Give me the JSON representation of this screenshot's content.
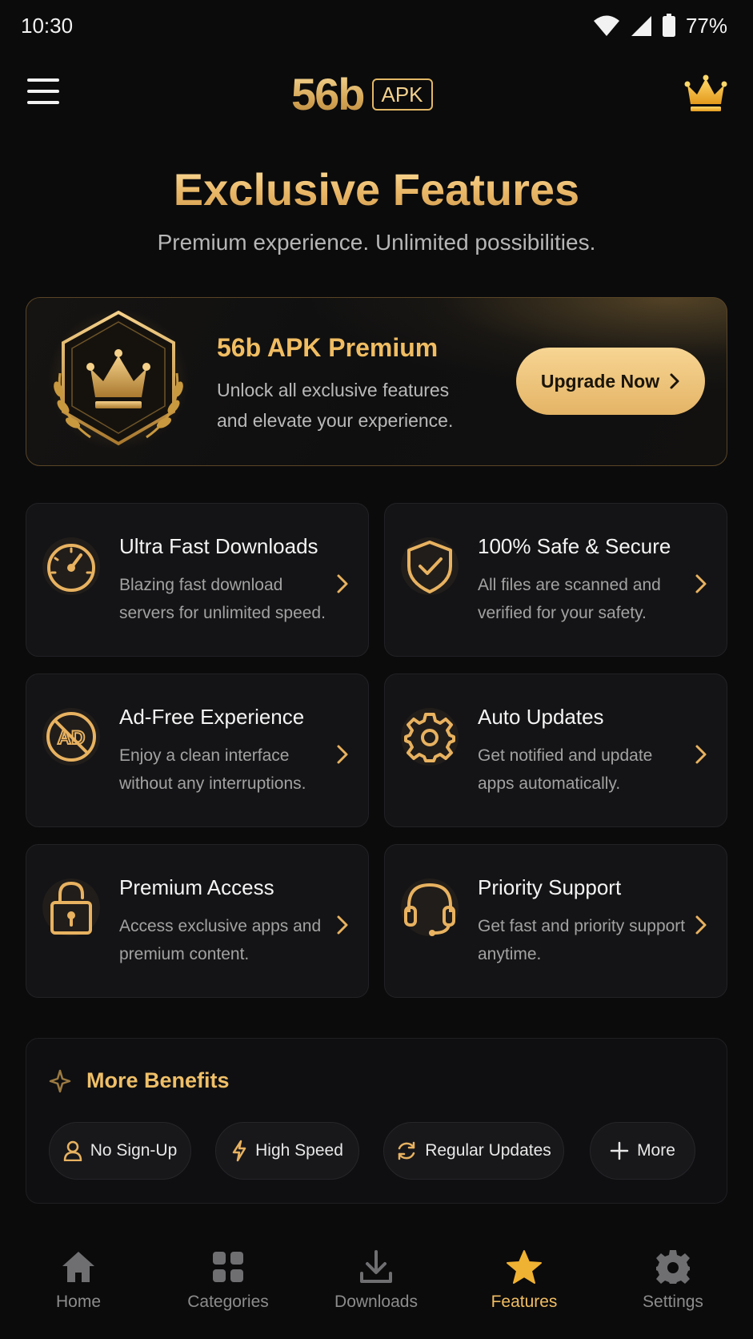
{
  "status_bar": {
    "time": "10:30",
    "battery": "77%"
  },
  "app_bar": {
    "logo_text": "56b",
    "logo_badge": "APK"
  },
  "hero": {
    "title": "Exclusive Features",
    "subtitle": "Premium experience. Unlimited possibilities."
  },
  "premium": {
    "title": "56b APK Premium",
    "description": "Unlock all exclusive features and elevate your experience.",
    "button_label": "Upgrade Now"
  },
  "features": [
    {
      "title": "Ultra Fast Downloads",
      "description": "Blazing fast download servers for unlimited speed.",
      "icon": "speedometer-icon"
    },
    {
      "title": "100% Safe & Secure",
      "description": "All files are scanned and verified for your safety.",
      "icon": "shield-check-icon"
    },
    {
      "title": "Ad-Free Experience",
      "description": "Enjoy a clean interface without any interruptions.",
      "icon": "no-ads-icon"
    },
    {
      "title": "Auto Updates",
      "description": "Get notified and update apps automatically.",
      "icon": "gear-icon"
    },
    {
      "title": "Premium Access",
      "description": "Access exclusive apps and premium content.",
      "icon": "unlock-icon"
    },
    {
      "title": "Priority Support",
      "description": "Get fast and priority support anytime.",
      "icon": "headset-icon"
    }
  ],
  "benefits": {
    "title": "More Benefits",
    "chips": [
      {
        "label": "No Sign-Up",
        "icon": "user-icon"
      },
      {
        "label": "High Speed",
        "icon": "lightning-icon"
      },
      {
        "label": "Regular Updates",
        "icon": "refresh-icon"
      },
      {
        "label": "More",
        "icon": "plus-icon"
      }
    ]
  },
  "bottom_nav": [
    {
      "label": "Home",
      "icon": "home-icon",
      "active": false
    },
    {
      "label": "Categories",
      "icon": "grid-icon",
      "active": false
    },
    {
      "label": "Downloads",
      "icon": "download-icon",
      "active": false
    },
    {
      "label": "Features",
      "icon": "star-icon",
      "active": true
    },
    {
      "label": "Settings",
      "icon": "settings-icon",
      "active": false
    }
  ],
  "colors": {
    "accent": "#F0BD62",
    "background": "#0B0B0C",
    "card": "#141416",
    "muted": "#8C8C8C"
  }
}
